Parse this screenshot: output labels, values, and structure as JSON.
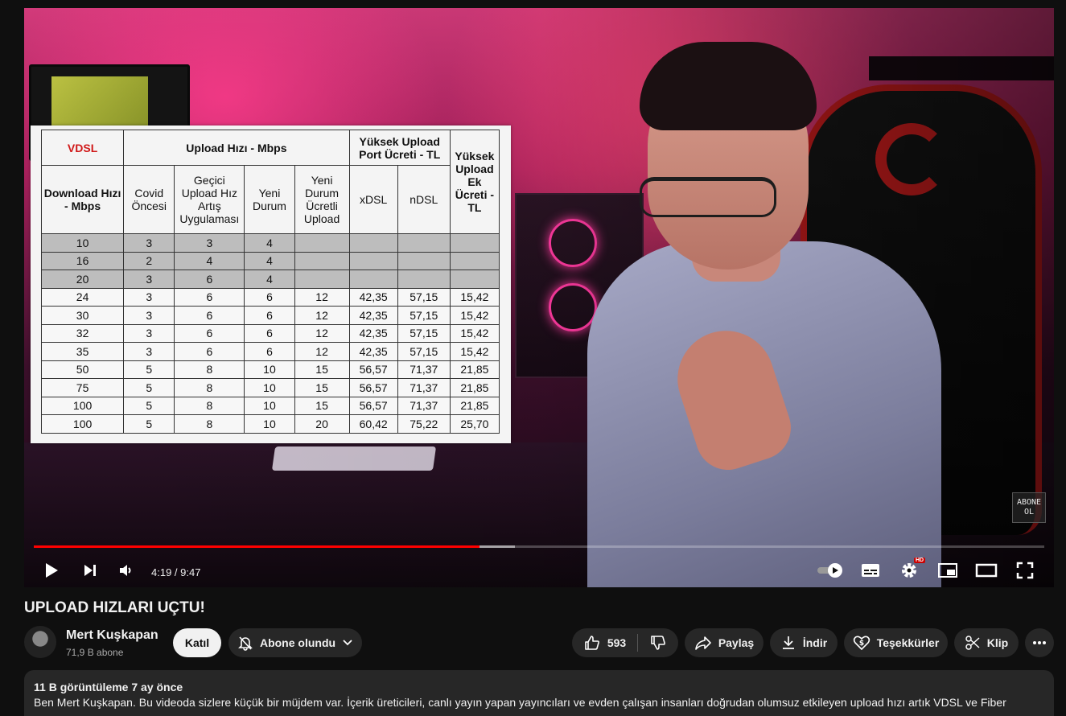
{
  "video": {
    "title": "UPLOAD HIZLARI UÇTU!",
    "current_time": "4:19",
    "duration": "9:47",
    "time_display": "4:19 / 9:47",
    "progress_fraction": 0.441,
    "buffered_fraction": 0.476,
    "quality_badge": "HD",
    "subscribe_watermark": "ABONE OL",
    "accent_color": "#ff0000"
  },
  "overlay_table": {
    "header": {
      "vdsl": "VDSL",
      "upload_group": "Upload Hızı - Mbps",
      "port_group": "Yüksek Upload Port Ücreti - TL",
      "extra_fee": "Yüksek Upload Ek Ücreti - TL",
      "download": "Download Hızı - Mbps",
      "covid": "Covid Öncesi",
      "temporary": "Geçici Upload Hız Artış Uygulaması",
      "new_state": "Yeni Durum",
      "new_paid": "Yeni Durum Ücretli Upload",
      "xdsl": "xDSL",
      "ndsl": "nDSL"
    },
    "rows": [
      {
        "c": [
          "10",
          "3",
          "3",
          "4",
          "",
          "",
          "",
          ""
        ],
        "grey": true
      },
      {
        "c": [
          "16",
          "2",
          "4",
          "4",
          "",
          "",
          "",
          ""
        ],
        "grey": true
      },
      {
        "c": [
          "20",
          "3",
          "6",
          "4",
          "",
          "",
          "",
          ""
        ],
        "grey": true
      },
      {
        "c": [
          "24",
          "3",
          "6",
          "6",
          "12",
          "42,35",
          "57,15",
          "15,42"
        ],
        "grey": false
      },
      {
        "c": [
          "30",
          "3",
          "6",
          "6",
          "12",
          "42,35",
          "57,15",
          "15,42"
        ],
        "grey": false
      },
      {
        "c": [
          "32",
          "3",
          "6",
          "6",
          "12",
          "42,35",
          "57,15",
          "15,42"
        ],
        "grey": false
      },
      {
        "c": [
          "35",
          "3",
          "6",
          "6",
          "12",
          "42,35",
          "57,15",
          "15,42"
        ],
        "grey": false
      },
      {
        "c": [
          "50",
          "5",
          "8",
          "10",
          "15",
          "56,57",
          "71,37",
          "21,85"
        ],
        "grey": false
      },
      {
        "c": [
          "75",
          "5",
          "8",
          "10",
          "15",
          "56,57",
          "71,37",
          "21,85"
        ],
        "grey": false
      },
      {
        "c": [
          "100",
          "5",
          "8",
          "10",
          "15",
          "56,57",
          "71,37",
          "21,85"
        ],
        "grey": false
      },
      {
        "c": [
          "100",
          "5",
          "8",
          "10",
          "20",
          "60,42",
          "75,22",
          "25,70"
        ],
        "grey": false
      }
    ]
  },
  "channel": {
    "name": "Mert Kuşkapan",
    "subscribers": "71,9 B abone",
    "join_label": "Katıl",
    "subscribed_label": "Abone olundu"
  },
  "actions": {
    "like_count": "593",
    "share_label": "Paylaş",
    "download_label": "İndir",
    "thanks_label": "Teşekkürler",
    "clip_label": "Klip"
  },
  "description": {
    "meta": "11 B görüntüleme  7 ay önce",
    "text": "Ben Mert Kuşkapan. Bu videoda sizlere küçük bir müjdem var. İçerik üreticileri, canlı yayın yapan yayıncıları ve evden çalışan insanları doğrudan olumsuz etkileyen upload hızı artık VDSL ve Fiber"
  }
}
